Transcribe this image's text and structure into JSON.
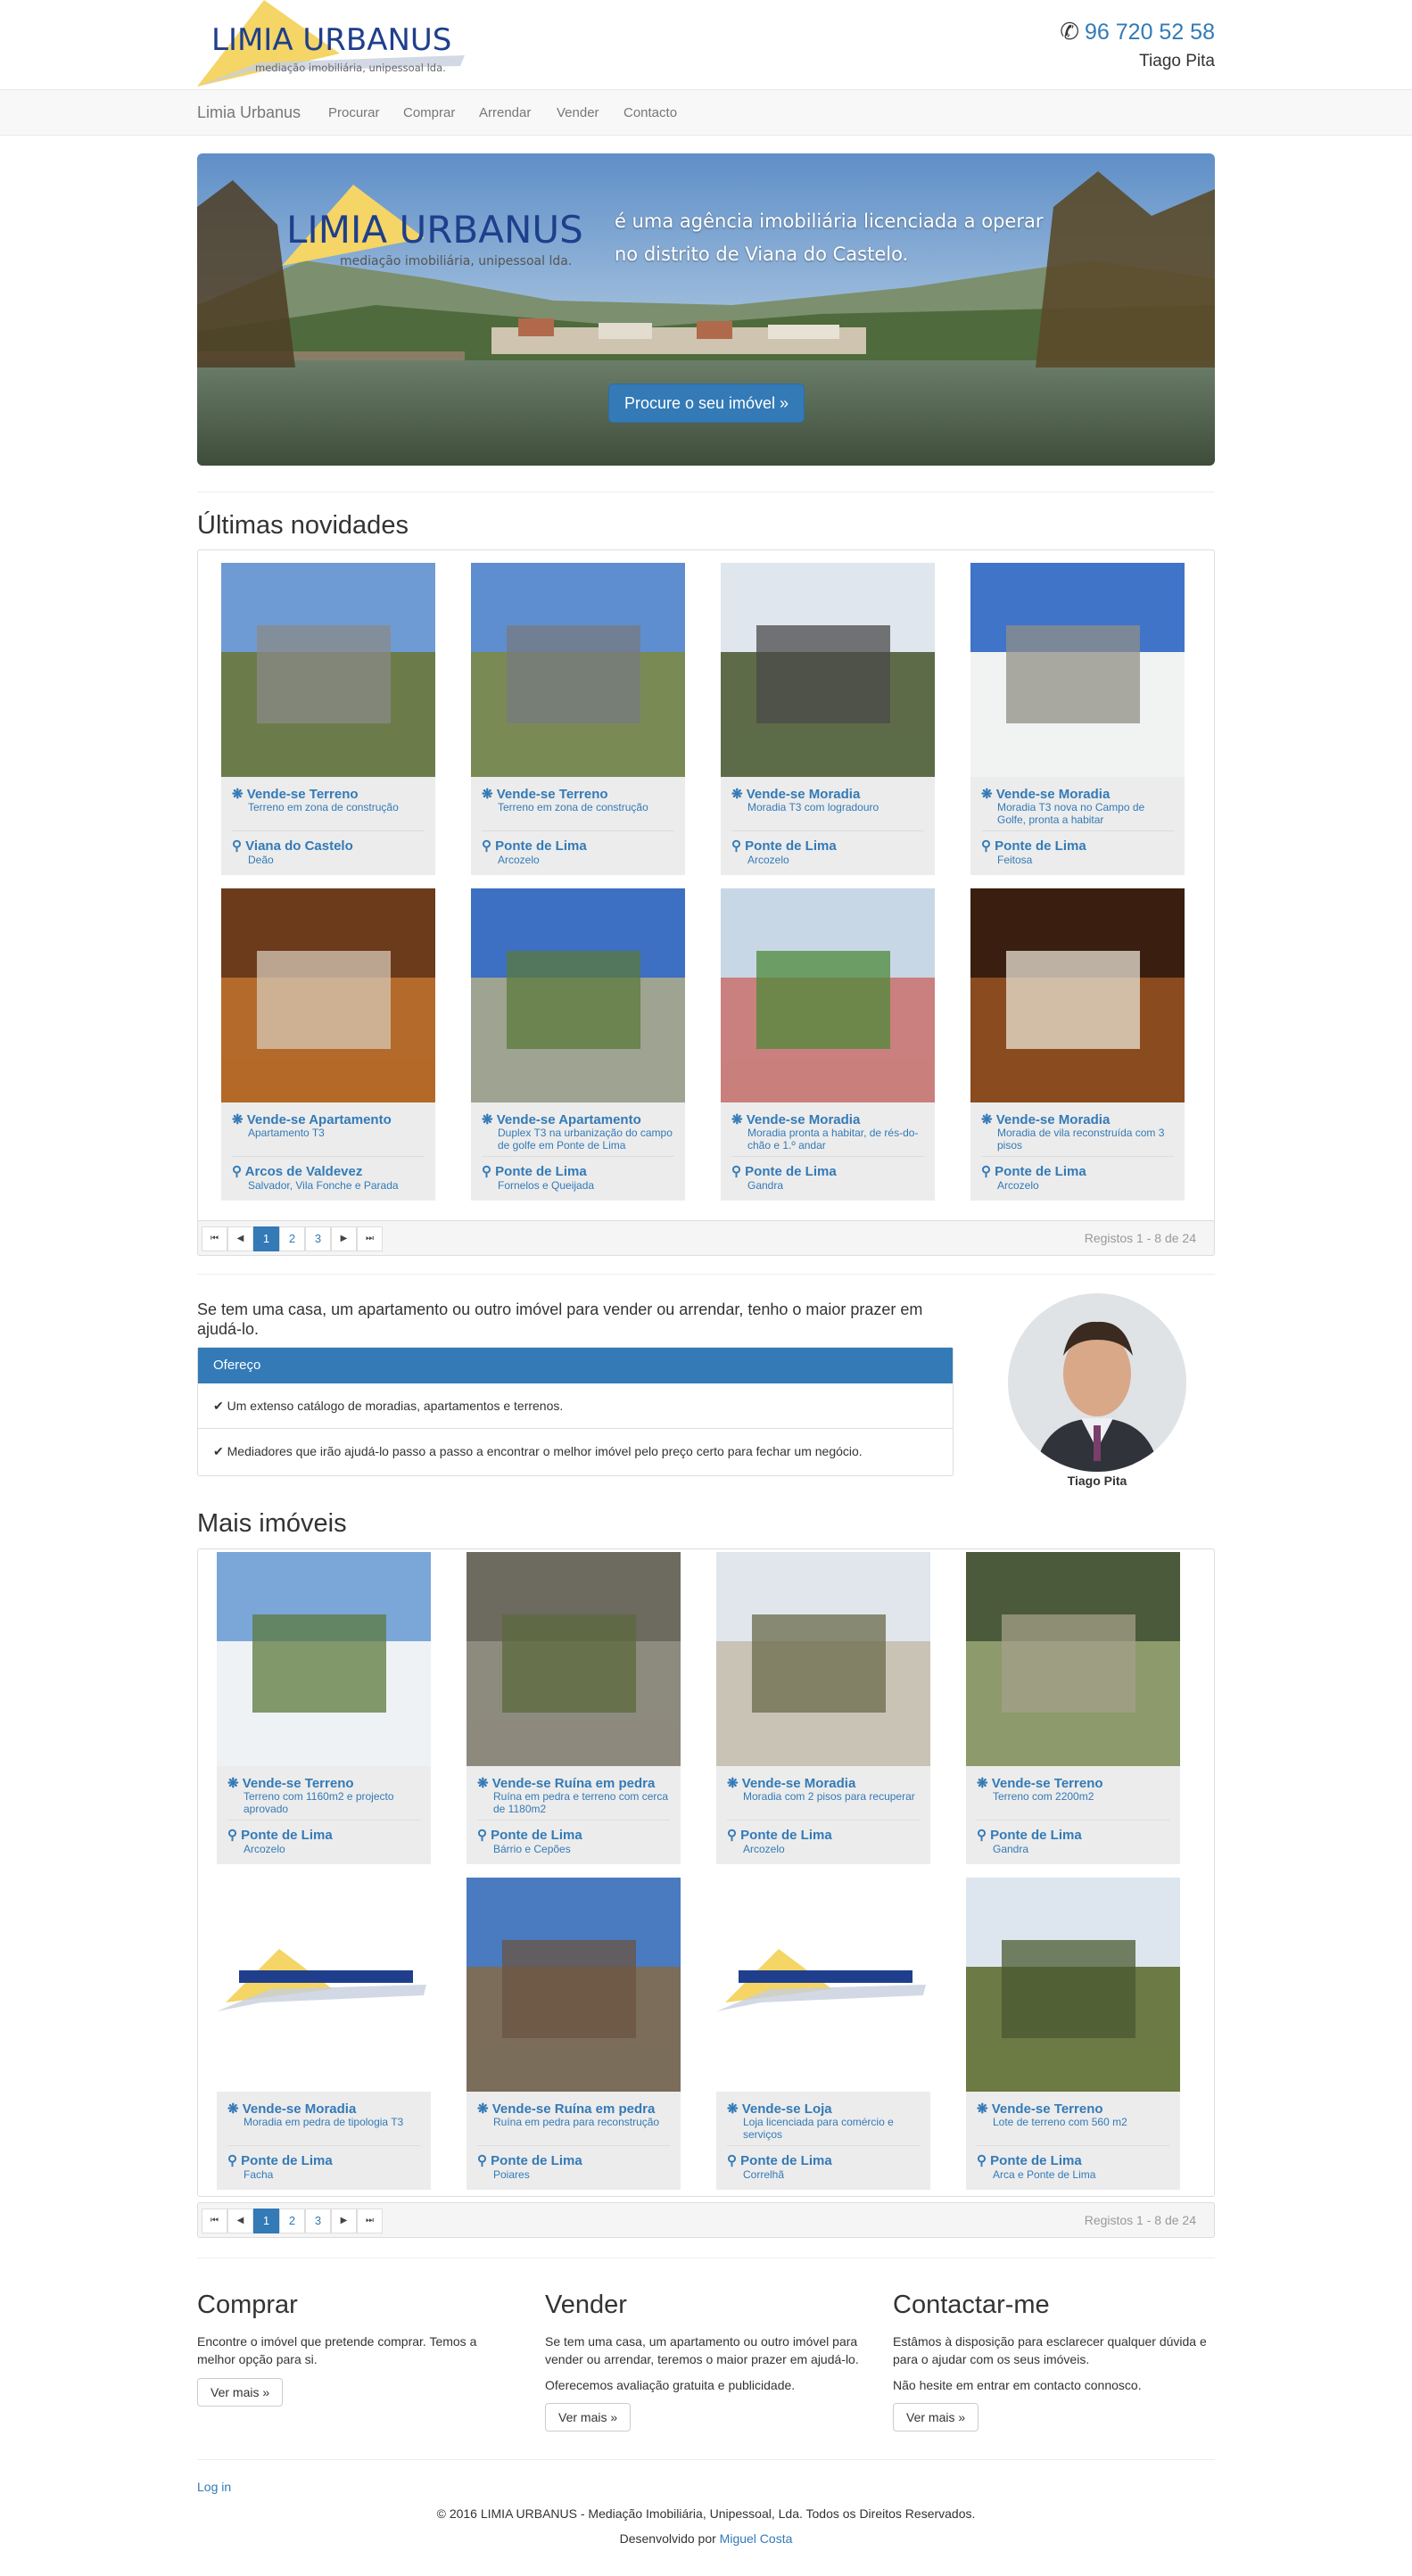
{
  "header": {
    "logo_title": "LIMIA URBANUS",
    "logo_subtitle": "mediação imobiliária, unipessoal lda.",
    "phone": "96 720 52 58",
    "agent_name": "Tiago Pita"
  },
  "navbar": {
    "brand": "Limia Urbanus",
    "items": [
      "Procurar",
      "Comprar",
      "Arrendar",
      "Vender",
      "Contacto"
    ]
  },
  "hero": {
    "logo_title": "LIMIA URBANUS",
    "logo_subtitle": "mediação imobiliária, unipessoal lda.",
    "line1": "é uma agência imobiliária licenciada a operar",
    "line2": "no distrito de Viana do Castelo.",
    "button": "Procure o seu imóvel »"
  },
  "latest": {
    "title": "Últimas novidades",
    "cards": [
      {
        "title": "Vende-se Terreno",
        "desc": "Terreno em zona de construção",
        "location": "Viana do Castelo",
        "sublocation": "Deão"
      },
      {
        "title": "Vende-se Terreno",
        "desc": "Terreno em zona de construção",
        "location": "Ponte de Lima",
        "sublocation": "Arcozelo"
      },
      {
        "title": "Vende-se Moradia",
        "desc": "Moradia T3 com logradouro",
        "location": "Ponte de Lima",
        "sublocation": "Arcozelo"
      },
      {
        "title": "Vende-se Moradia",
        "desc": "Moradia T3 nova no Campo de Golfe, pronta a habitar",
        "location": "Ponte de Lima",
        "sublocation": "Feitosa"
      },
      {
        "title": "Vende-se Apartamento",
        "desc": "Apartamento T3",
        "location": "Arcos de Valdevez",
        "sublocation": "Salvador, Vila Fonche e Parada"
      },
      {
        "title": "Vende-se Apartamento",
        "desc": "Duplex T3 na urbanização do campo de golfe em Ponte de Lima",
        "location": "Ponte de Lima",
        "sublocation": "Fornelos e Queijada"
      },
      {
        "title": "Vende-se Moradia",
        "desc": "Moradia pronta a habitar, de rés-do-chão e 1.º andar",
        "location": "Ponte de Lima",
        "sublocation": "Gandra"
      },
      {
        "title": "Vende-se Moradia",
        "desc": "Moradia de vila reconstruída com 3 pisos",
        "location": "Ponte de Lima",
        "sublocation": "Arcozelo"
      }
    ],
    "pager": {
      "pages": [
        "1",
        "2",
        "3"
      ],
      "records": "Registos 1 - 8 de 24"
    }
  },
  "sell": {
    "intro": "Se tem uma casa, um apartamento ou outro imóvel para vender ou arrendar, tenho o maior prazer em ajudá-lo.",
    "panel_title": "Ofereço",
    "items": [
      "Um extenso catálogo de moradias, apartamentos e terrenos.",
      "Mediadores que irão ajudá-lo passo a passo a encontrar o melhor imóvel pelo preço certo para fechar um negócio."
    ],
    "agent_name": "Tiago Pita"
  },
  "more": {
    "title": "Mais imóveis",
    "cards": [
      {
        "title": "Vende-se Terreno",
        "desc": "Terreno com 1160m2 e projecto aprovado",
        "location": "Ponte de Lima",
        "sublocation": "Arcozelo"
      },
      {
        "title": "Vende-se Ruína em pedra",
        "desc": "Ruína em pedra e terreno com cerca de 1180m2",
        "location": "Ponte de Lima",
        "sublocation": "Bárrio e Cepões"
      },
      {
        "title": "Vende-se Moradia",
        "desc": "Moradia com 2 pisos para recuperar",
        "location": "Ponte de Lima",
        "sublocation": "Arcozelo"
      },
      {
        "title": "Vende-se Terreno",
        "desc": "Terreno com 2200m2",
        "location": "Ponte de Lima",
        "sublocation": "Gandra"
      },
      {
        "title": "Vende-se Moradia",
        "desc": "Moradia em pedra de tipologia T3",
        "location": "Ponte de Lima",
        "sublocation": "Facha"
      },
      {
        "title": "Vende-se Ruína em pedra",
        "desc": "Ruína em pedra para reconstrução",
        "location": "Ponte de Lima",
        "sublocation": "Poiares"
      },
      {
        "title": "Vende-se Loja",
        "desc": "Loja licenciada para comércio e serviços",
        "location": "Ponte de Lima",
        "sublocation": "Correlhã"
      },
      {
        "title": "Vende-se Terreno",
        "desc": "Lote de terreno com 560 m2",
        "location": "Ponte de Lima",
        "sublocation": "Arca e Ponte de Lima"
      }
    ],
    "pager": {
      "pages": [
        "1",
        "2",
        "3"
      ],
      "records": "Registos 1 - 8 de 24"
    }
  },
  "columns": [
    {
      "title": "Comprar",
      "paragraphs": [
        "Encontre o imóvel que pretende comprar. Temos a melhor opção para si."
      ],
      "button": "Ver mais »"
    },
    {
      "title": "Vender",
      "paragraphs": [
        "Se tem uma casa, um apartamento ou outro imóvel para vender ou arrendar, teremos o maior prazer em ajudá-lo.",
        "Oferecemos avaliação gratuita e publicidade."
      ],
      "button": "Ver mais »"
    },
    {
      "title": "Contactar-me",
      "paragraphs": [
        "Estâmos à disposição para esclarecer qualquer dúvida e para o ajudar com os seus imóveis.",
        "Não hesite em entrar em contacto connosco."
      ],
      "button": "Ver mais »"
    }
  ],
  "footer": {
    "login": "Log in",
    "copyright": "© 2016 LIMIA URBANUS - Mediação Imobiliária, Unipessoal, Lda. Todos os Direitos Reservados.",
    "dev_prefix": "Desenvolvido por",
    "dev_name": "Miguel Costa"
  },
  "colors": {
    "primary": "#337ab7",
    "card_bg": "#ececec",
    "logo_blue": "#1f3f8c",
    "logo_yellow": "#f4d565"
  },
  "icons": [
    "phone-icon",
    "asterisk-icon",
    "map-marker-icon",
    "checkmark-icon",
    "first-page-icon",
    "prev-page-icon",
    "next-page-icon",
    "last-page-icon"
  ]
}
